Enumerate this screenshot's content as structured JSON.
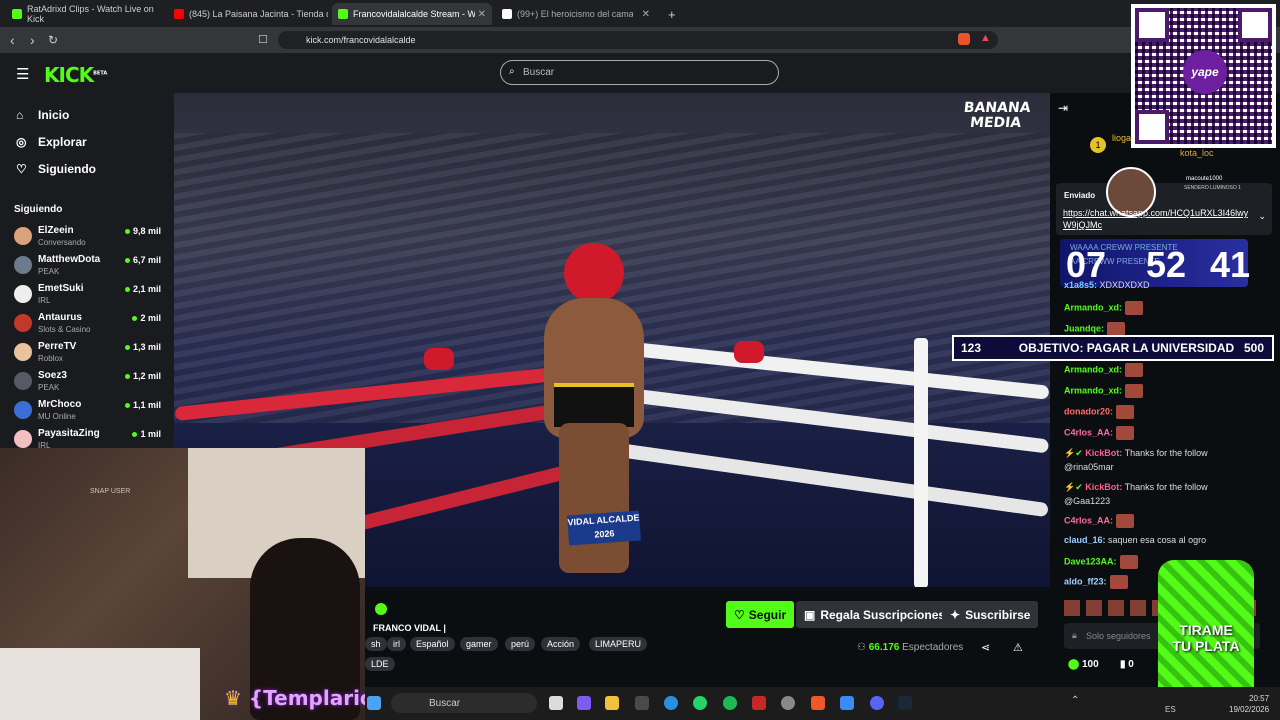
{
  "browser": {
    "tabs": [
      {
        "title": "RatAdrixd Clips - Watch Live on Kick",
        "favicon_color": "#53fc18"
      },
      {
        "title": "(845) La Paisana Jacinta - Tienda de l",
        "favicon_color": "#ff0000"
      },
      {
        "title": "Francovidalalcalde Stream - W",
        "favicon_color": "#53fc18"
      },
      {
        "title": "(99+) El heroicismo del camarógr",
        "favicon_color": "#ffffff"
      }
    ],
    "url": "kick.com/francovidalalcalde"
  },
  "header": {
    "logo": "KICK",
    "logo_badge": "BETA",
    "search_placeholder": "Buscar"
  },
  "sidebar": {
    "nav": [
      {
        "label": "Inicio",
        "icon": "home-icon"
      },
      {
        "label": "Explorar",
        "icon": "compass-icon"
      },
      {
        "label": "Siguiendo",
        "icon": "heart-icon"
      }
    ],
    "following_title": "Siguiendo",
    "channels": [
      {
        "name": "ElZeein",
        "category": "Conversando",
        "viewers": "9,8 mil",
        "color": "#d9a27a"
      },
      {
        "name": "MatthewDota",
        "category": "PEAK",
        "viewers": "6,7 mil",
        "color": "#6b7b8c"
      },
      {
        "name": "EmetSuki",
        "category": "IRL",
        "viewers": "2,1 mil",
        "color": "#eeeeee"
      },
      {
        "name": "Antaurus",
        "category": "Slots & Casino",
        "viewers": "2 mil",
        "color": "#c0392b"
      },
      {
        "name": "PerreTV",
        "category": "Roblox",
        "viewers": "1,3 mil",
        "color": "#e8c39e"
      },
      {
        "name": "Soez3",
        "category": "PEAK",
        "viewers": "1,2 mil",
        "color": "#555a66"
      },
      {
        "name": "MrChoco",
        "category": "MU Online",
        "viewers": "1,1 mil",
        "color": "#3b6fd6"
      },
      {
        "name": "PayasitaZing",
        "category": "IRL",
        "viewers": "1 mil",
        "color": "#f2c0c0"
      }
    ]
  },
  "video": {
    "watermark_line1": "BANANA",
    "watermark_line2": "MEDIA",
    "banner": "VIDAL ALCALDE 2026"
  },
  "stream_info": {
    "title": "FRANCO VIDAL |",
    "follow_label": "Seguir",
    "gift_label": "Regala Suscripciones",
    "subscribe_label": "Suscribirse",
    "tags": [
      "sh",
      "irl",
      "Español",
      "gamer",
      "perú",
      "Acción",
      "LIMAPERU"
    ],
    "extra_tag": "LDE",
    "viewers": "66.176",
    "viewers_label": "Espectadores"
  },
  "chat": {
    "top_user": "lioga",
    "top_user2": "kota_loc",
    "pinned_label": "Enviado",
    "pinned_user": "macoute1000",
    "pinned_sub": "SENDERO LUMINOSO 1",
    "pinned_link": "https://chat.whatsapp.com/HCQ1uRXL3I46lwyW9jQJMc",
    "timer": {
      "h": "07",
      "m": "52",
      "s": "41"
    },
    "faded_lines": [
      "WAAAA CREWW PRESENTE",
      "AA CREWW PRESENTE"
    ],
    "messages": [
      {
        "user": "x1a8s5:",
        "text": "XDXDXDXD",
        "color": "#7ad0ff"
      },
      {
        "user": "Armando_xd:",
        "text": "",
        "color": "#53fc18"
      },
      {
        "user": "Juandqe:",
        "text": "",
        "color": "#53fc18"
      },
      {
        "user": "Armando_xd:",
        "text": "",
        "color": "#53fc18"
      },
      {
        "user": "Armando_xd:",
        "text": "",
        "color": "#53fc18"
      },
      {
        "user": "donador20:",
        "text": "",
        "color": "#ff6b6b"
      },
      {
        "user": "C4rlos_AA:",
        "text": "",
        "color": "#ff6b9e"
      },
      {
        "user": "KickBot:",
        "text": "Thanks for the follow",
        "text2": "@rina05mar",
        "color": "#ff5c8a"
      },
      {
        "user": "KickBot:",
        "text": "Thanks for the follow",
        "text2": "@Gaa1223",
        "color": "#ff5c8a"
      },
      {
        "user": "C4rlos_AA:",
        "text": "",
        "color": "#ff6b9e"
      },
      {
        "user": "claud_16:",
        "text": "saquen esa cosa al ogro",
        "color": "#9bd0ff"
      },
      {
        "user": "Dave123AA:",
        "text": "",
        "color": "#53fc18"
      },
      {
        "user": "aldo_ff23:",
        "text": "",
        "color": "#9bd0ff"
      }
    ],
    "input_placeholder": "Solo seguidores",
    "points": "100",
    "points2": "0"
  },
  "goal": {
    "current": "123",
    "label": "OBJETIVO: PAGAR LA UNIVERSIDAD",
    "target": "500"
  },
  "overlay": {
    "streamer_tag": "{TemplarioX}",
    "yape_label": "yape",
    "tirame_line1": "TIRAME",
    "tirame_line2": "TU PLATA",
    "cam_caption": "SNAP USER"
  },
  "taskbar": {
    "search_placeholder": "Buscar",
    "time": "20:57",
    "date": "19/02/2026",
    "lang": "ES"
  }
}
